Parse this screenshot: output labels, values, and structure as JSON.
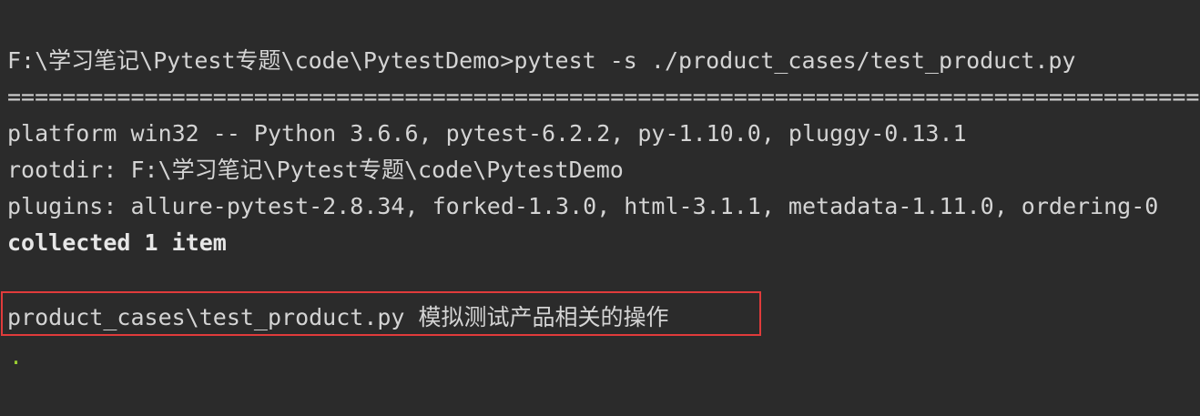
{
  "terminal": {
    "command_line": "F:\\学习笔记\\Pytest专题\\code\\PytestDemo>pytest -s ./product_cases/test_product.py",
    "separator": "==================================================================================================",
    "platform_line": "platform win32 -- Python 3.6.6, pytest-6.2.2, py-1.10.0, pluggy-0.13.1",
    "rootdir_line": "rootdir: F:\\学习笔记\\Pytest专题\\code\\PytestDemo",
    "plugins_line": "plugins: allure-pytest-2.8.34, forked-1.3.0, html-3.1.1, metadata-1.11.0, ordering-0",
    "collected_line": "collected 1 item",
    "test_line": "product_cases\\test_product.py 模拟测试产品相关的操作",
    "progress_dot": "."
  },
  "colors": {
    "background": "#2b2b2b",
    "text": "#d4d4d4",
    "highlight_border": "#e03b3b",
    "pass_dot": "#9acd32"
  }
}
